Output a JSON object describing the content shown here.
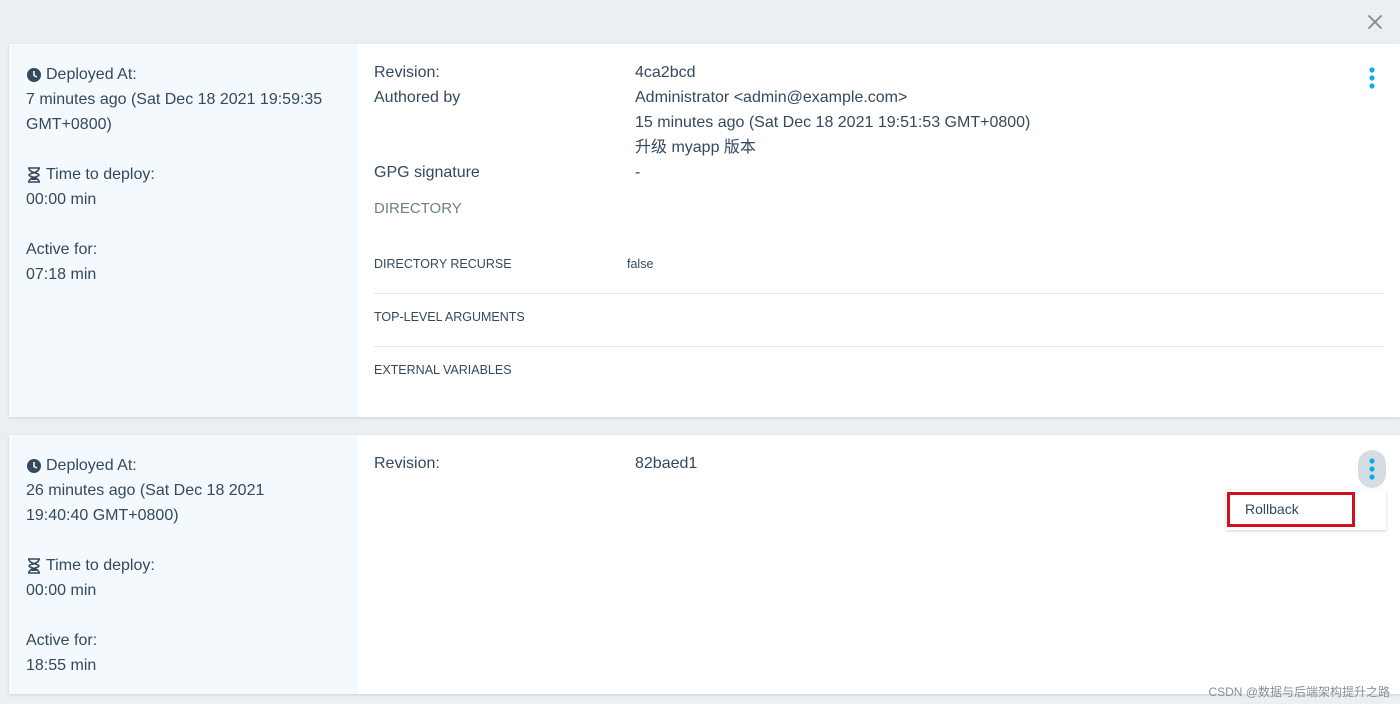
{
  "close_icon": "close-icon",
  "deployments": [
    {
      "deployed_at_label": "Deployed At:",
      "deployed_at_line1": "7 minutes ago (Sat Dec 18 2021 19:59:35",
      "deployed_at_line2": "GMT+0800)",
      "time_to_deploy_label": "Time to deploy:",
      "time_to_deploy_value": "00:00 min",
      "active_for_label": "Active for:",
      "active_for_value": "07:18 min",
      "revision_label": "Revision:",
      "revision_value": "4ca2bcd",
      "authored_by_label": "Authored by",
      "author": "Administrator <admin@example.com>",
      "authored_time": "15 minutes ago (Sat Dec 18 2021 19:51:53 GMT+0800)",
      "commit_message": "升级 myapp 版本",
      "gpg_label": "GPG signature",
      "gpg_value": "-",
      "directory_title": "DIRECTORY",
      "params": [
        {
          "key": "DIRECTORY RECURSE",
          "value": "false"
        },
        {
          "key": "TOP-LEVEL ARGUMENTS",
          "value": ""
        },
        {
          "key": "EXTERNAL VARIABLES",
          "value": ""
        }
      ]
    },
    {
      "deployed_at_label": "Deployed At:",
      "deployed_at_line1": "26 minutes ago (Sat Dec 18 2021",
      "deployed_at_line2": "19:40:40 GMT+0800)",
      "time_to_deploy_label": "Time to deploy:",
      "time_to_deploy_value": "00:00 min",
      "active_for_label": "Active for:",
      "active_for_value": "18:55 min",
      "revision_label": "Revision:",
      "revision_value": "82baed1",
      "menu_item": "Rollback"
    }
  ],
  "watermark": "CSDN @数据与后端架构提升之路",
  "colors": {
    "accent": "#0dadea",
    "highlight": "#d3101e",
    "sidebar_bg": "#f3f9fc"
  }
}
